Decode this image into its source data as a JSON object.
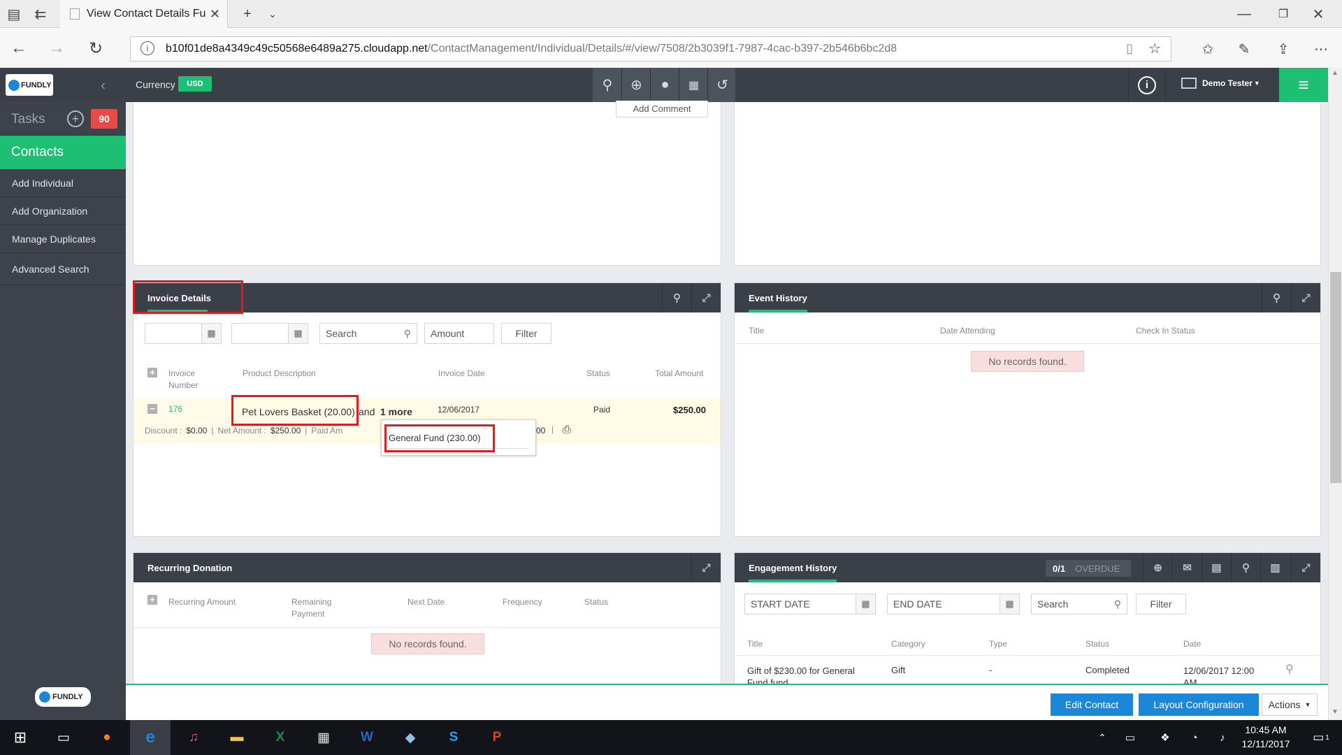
{
  "browser": {
    "tab_title": "View Contact Details Fu",
    "url_host": "b10f01de8a4349c49c50568e6489a275.cloudapp.net",
    "url_path": "/ContactManagement/Individual/Details/#/view/7508/2b3039f1-7987-4cac-b397-2b546b6bc2d8"
  },
  "header": {
    "brand": "FUNDLY",
    "currency_label": "Currency",
    "currency_value": "USD",
    "user_name": "Demo Tester",
    "add_comment": "Add Comment"
  },
  "sidebar": {
    "tasks_label": "Tasks",
    "tasks_count": "90",
    "active": "Contacts",
    "items": [
      "Add Individual",
      "Add Organization",
      "Manage Duplicates",
      "Advanced Search"
    ],
    "footer_brand": "FUNDLY"
  },
  "invoice": {
    "title": "Invoice Details",
    "search_placeholder": "Search",
    "amount_placeholder": "Amount",
    "filter_label": "Filter",
    "columns": [
      "Invoice\nNumber",
      "Product Description",
      "Invoice Date",
      "Status",
      "Total Amount"
    ],
    "row": {
      "number": "176",
      "product": "Pet Lovers Basket (20.00)",
      "and_text": "and",
      "more_text": "1 more",
      "date": "12/06/2017",
      "status": "Paid",
      "total": "$250.00"
    },
    "detail": {
      "discount_label": "Discount :",
      "discount_value": "$0.00",
      "net_label": "Net Amount :",
      "net_value": "$250.00",
      "paid_label": "Paid Am",
      "paid_tail": "00"
    },
    "popup_item": "General Fund (230.00)"
  },
  "event_history": {
    "title": "Event History",
    "columns": [
      "Title",
      "Date Attending",
      "Check In Status"
    ],
    "empty": "No records found."
  },
  "recurring": {
    "title": "Recurring Donation",
    "columns": [
      "Recurring Amount",
      "Remaining\nPayment",
      "Next Date",
      "Frequency",
      "Status"
    ],
    "empty": "No records found."
  },
  "engagement": {
    "title": "Engagement History",
    "overdue_count": "0/1",
    "overdue_label": "OVERDUE",
    "start_placeholder": "START DATE",
    "end_placeholder": "END DATE",
    "search_placeholder": "Search",
    "filter_label": "Filter",
    "columns": [
      "Title",
      "Category",
      "Type",
      "Status",
      "Date"
    ],
    "row": {
      "title": "Gift of $230.00 for General",
      "title_2": "Fund fund",
      "category": "Gift",
      "type": "-",
      "status": "Completed",
      "date": "12/06/2017 12:00",
      "date_2": "AM"
    }
  },
  "footer": {
    "edit_contact": "Edit Contact",
    "layout_configuration": "Layout Configuration",
    "actions": "Actions"
  },
  "taskbar": {
    "time": "10:45 AM",
    "date": "12/11/2017",
    "notifications": "1"
  },
  "colors": {
    "accent": "#1dbf73",
    "header_bg": "#3a3f48",
    "highlight": "#e3191d",
    "primary_button": "#1a87d8"
  }
}
